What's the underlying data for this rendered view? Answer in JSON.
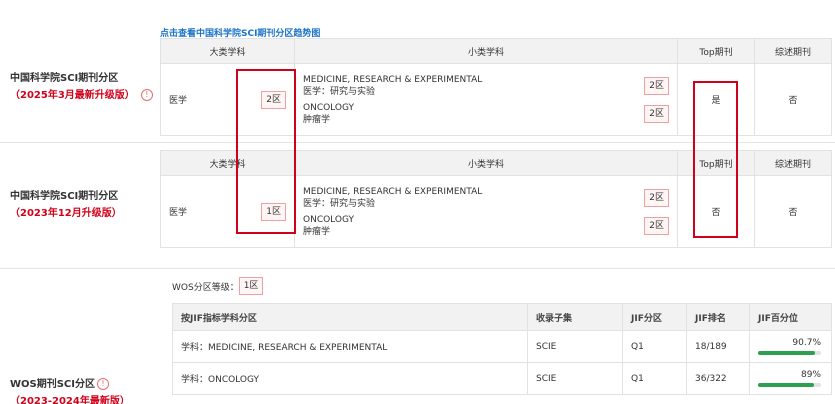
{
  "cas_2025": {
    "label": "中国科学院SCI期刊分区",
    "sublabel": "（2025年3月最新升级版）",
    "trend_link": "点击查看中国科学院SCI期刊分区趋势图",
    "headers": {
      "major": "大类学科",
      "minor": "小类学科",
      "top": "Top期刊",
      "review": "综述期刊"
    },
    "major_subject": "医学",
    "major_zone": "2区",
    "minor_subjects": [
      {
        "en": "MEDICINE, RESEARCH & EXPERIMENTAL",
        "zh": "医学：研究与实验",
        "zone": "2区"
      },
      {
        "en": "ONCOLOGY",
        "zh": "肿瘤学",
        "zone": "2区"
      }
    ],
    "top": "是",
    "review": "否"
  },
  "cas_2023": {
    "label": "中国科学院SCI期刊分区",
    "sublabel": "（2023年12月升级版）",
    "headers": {
      "major": "大类学科",
      "minor": "小类学科",
      "top": "Top期刊",
      "review": "综述期刊"
    },
    "major_subject": "医学",
    "major_zone": "1区",
    "minor_subjects": [
      {
        "en": "MEDICINE, RESEARCH & EXPERIMENTAL",
        "zh": "医学：研究与实验",
        "zone": "2区"
      },
      {
        "en": "ONCOLOGY",
        "zh": "肿瘤学",
        "zone": "2区"
      }
    ],
    "top": "否",
    "review": "否"
  },
  "wos": {
    "label": "WOS期刊SCI分区",
    "sublabel": "（2023-2024年最新版）",
    "grade_label": "WOS分区等级：",
    "grade_value": "1区",
    "headers": {
      "subject": "按JIF指标学科分区",
      "collection": "收录子集",
      "zone": "JIF分区",
      "rank": "JIF排名",
      "percentile": "JIF百分位"
    },
    "rows": [
      {
        "subject": "学科：MEDICINE, RESEARCH & EXPERIMENTAL",
        "collection": "SCIE",
        "zone": "Q1",
        "rank": "18/189",
        "percentile": "90.7%",
        "percentile_value": 90.7
      },
      {
        "subject": "学科：ONCOLOGY",
        "collection": "SCIE",
        "zone": "Q1",
        "rank": "36/322",
        "percentile": "89%",
        "percentile_value": 89
      }
    ]
  },
  "colors": {
    "highlight": "#d0021b",
    "bar": "#2e9e4f",
    "link": "#1a73c8"
  },
  "icons": {
    "info": "info-circle-icon"
  }
}
